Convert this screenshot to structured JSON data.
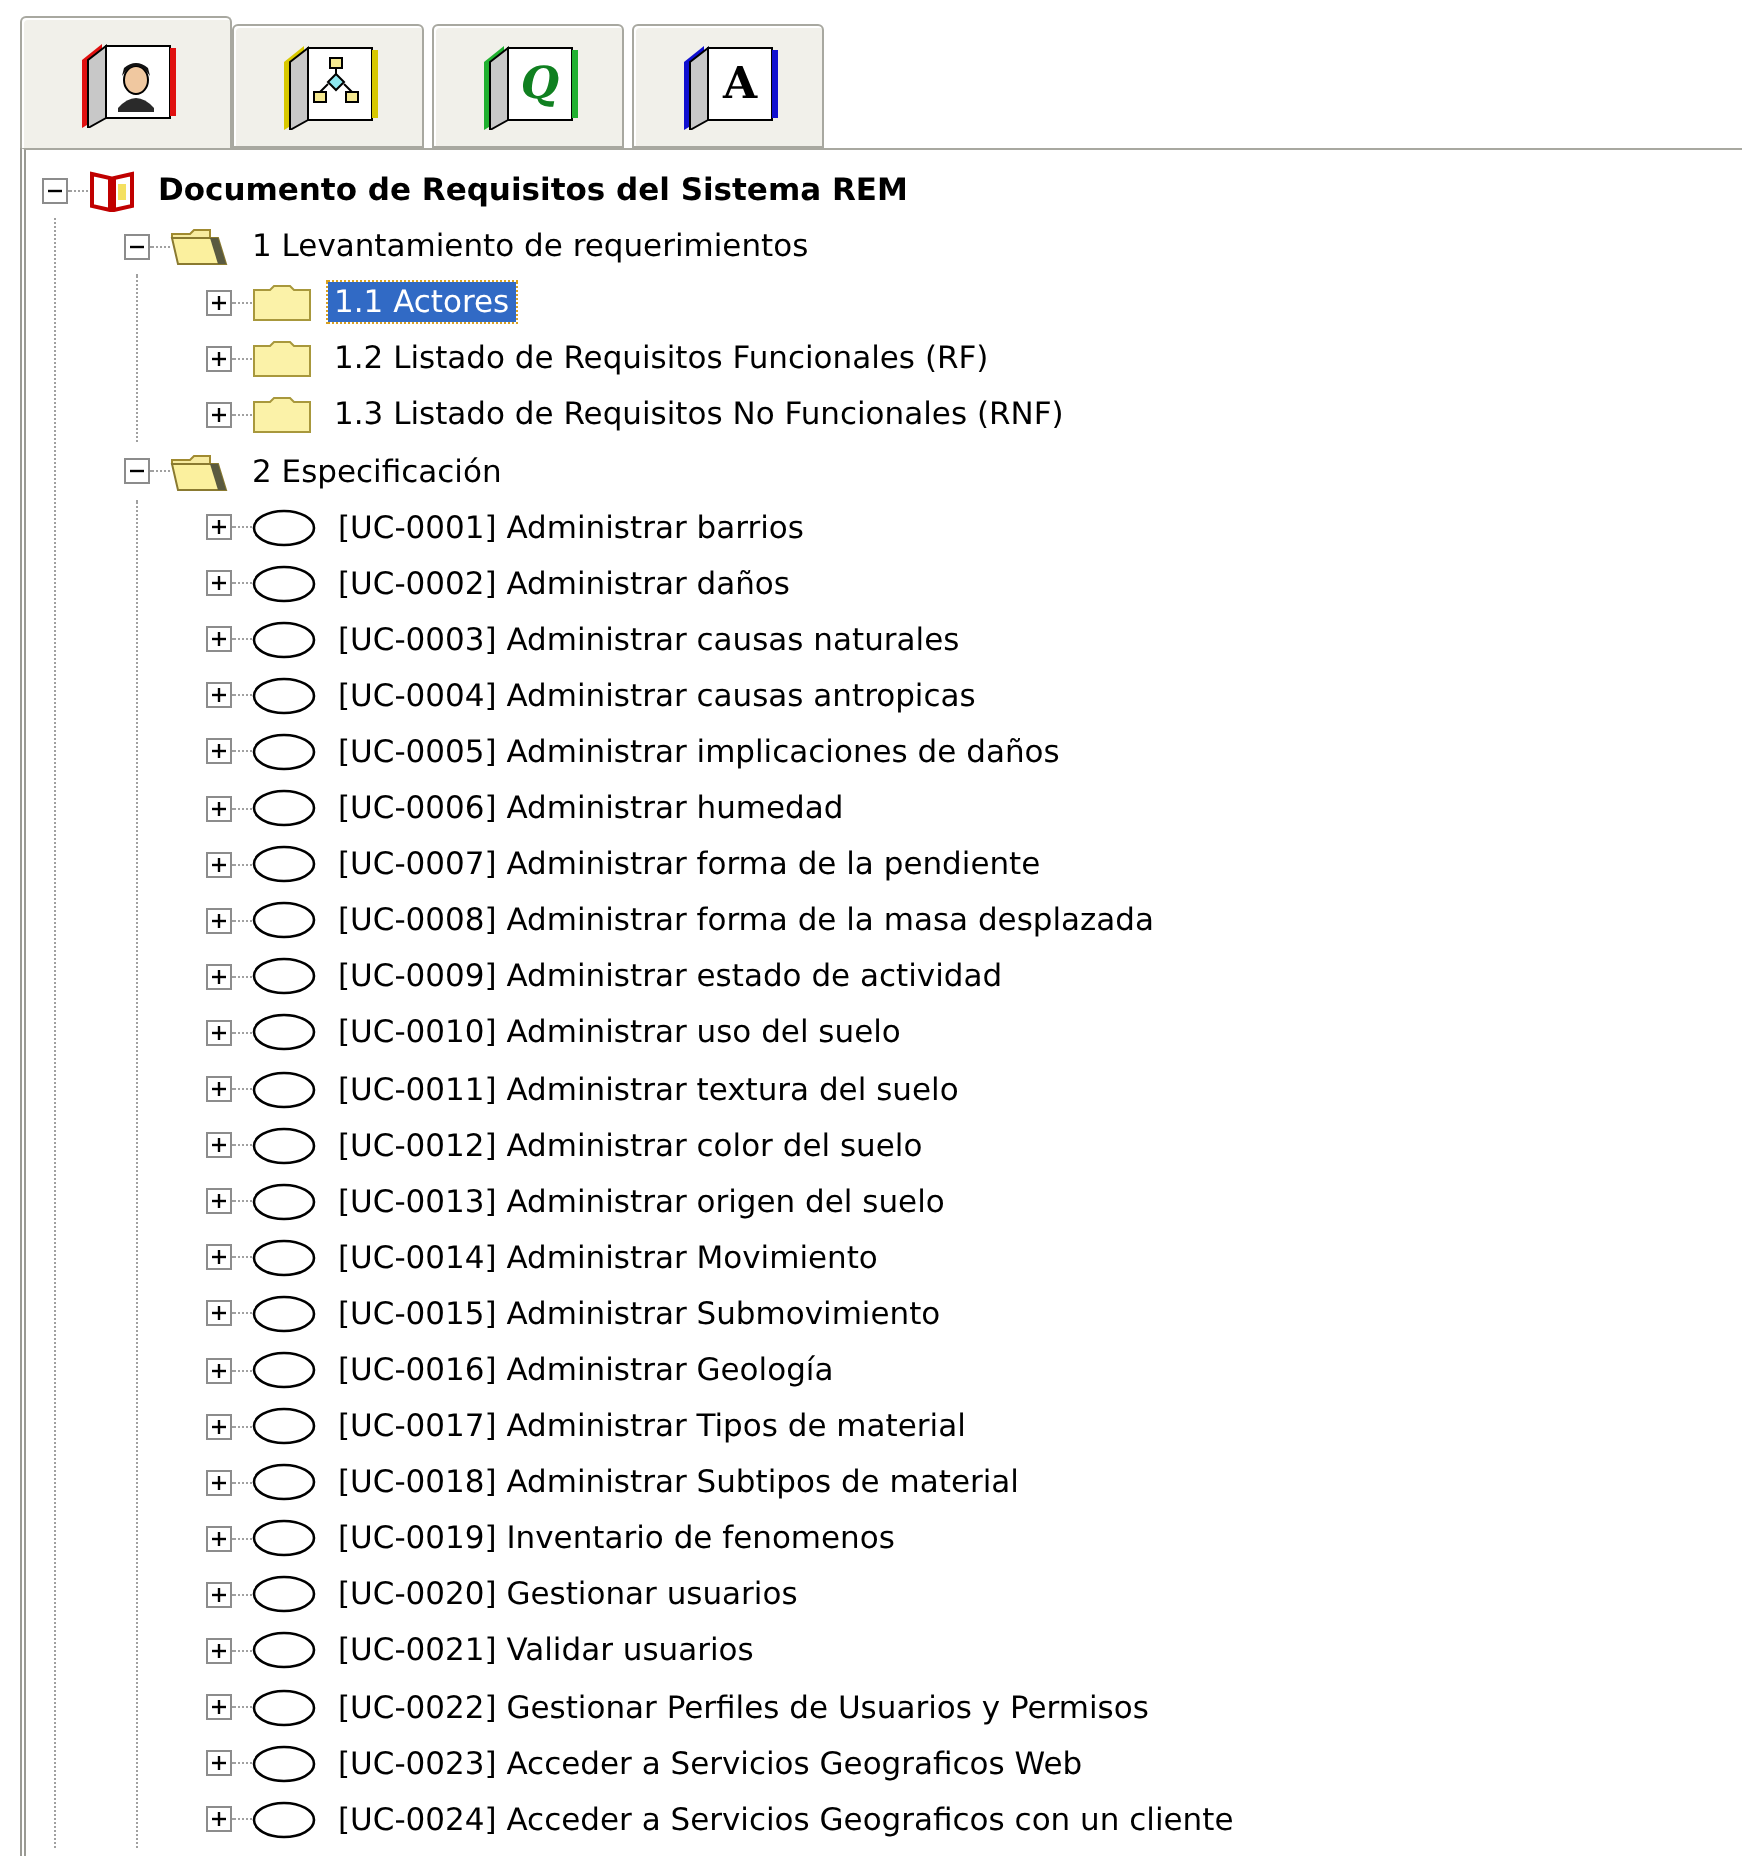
{
  "tabs": [
    {
      "kind": "person",
      "color": "#e01010",
      "selected": true
    },
    {
      "kind": "diagram",
      "color": "#d8c800",
      "selected": false
    },
    {
      "kind": "letter",
      "glyph": "Q",
      "color": "#20b030",
      "selected": false
    },
    {
      "kind": "letter",
      "glyph": "A",
      "color": "#1010d0",
      "selected": false
    }
  ],
  "tree": {
    "label": "Documento de Requisitos del Sistema REM",
    "kind": "document",
    "expanded": true,
    "selected": false,
    "children": [
      {
        "label": "1 Levantamiento de requerimientos",
        "kind": "folder",
        "expanded": true,
        "selected": false,
        "children": [
          {
            "label": "1.1 Actores",
            "kind": "folder",
            "expanded": false,
            "selected": true
          },
          {
            "label": "1.2 Listado de Requisitos Funcionales (RF)",
            "kind": "folder",
            "expanded": false,
            "selected": false
          },
          {
            "label": "1.3 Listado de Requisitos No Funcionales (RNF)",
            "kind": "folder",
            "expanded": false,
            "selected": false
          }
        ]
      },
      {
        "label": "2 Especificación",
        "kind": "folder",
        "expanded": true,
        "selected": false,
        "children": [
          {
            "label": "[UC-0001] Administrar barrios",
            "kind": "use_case",
            "expanded": false,
            "selected": false
          },
          {
            "label": "[UC-0002] Administrar daños",
            "kind": "use_case",
            "expanded": false,
            "selected": false
          },
          {
            "label": "[UC-0003] Administrar causas naturales",
            "kind": "use_case",
            "expanded": false,
            "selected": false
          },
          {
            "label": "[UC-0004] Administrar causas antropicas",
            "kind": "use_case",
            "expanded": false,
            "selected": false
          },
          {
            "label": "[UC-0005] Administrar implicaciones de daños",
            "kind": "use_case",
            "expanded": false,
            "selected": false
          },
          {
            "label": "[UC-0006] Administrar humedad",
            "kind": "use_case",
            "expanded": false,
            "selected": false
          },
          {
            "label": "[UC-0007] Administrar forma de la pendiente",
            "kind": "use_case",
            "expanded": false,
            "selected": false
          },
          {
            "label": "[UC-0008] Administrar forma de la masa desplazada",
            "kind": "use_case",
            "expanded": false,
            "selected": false
          },
          {
            "label": "[UC-0009] Administrar estado de actividad",
            "kind": "use_case",
            "expanded": false,
            "selected": false
          },
          {
            "label": "[UC-0010] Administrar uso del suelo",
            "kind": "use_case",
            "expanded": false,
            "selected": false
          },
          {
            "label": "[UC-0011] Administrar textura del suelo",
            "kind": "use_case",
            "expanded": false,
            "selected": false
          },
          {
            "label": "[UC-0012] Administrar color del suelo",
            "kind": "use_case",
            "expanded": false,
            "selected": false
          },
          {
            "label": "[UC-0013] Administrar origen del suelo",
            "kind": "use_case",
            "expanded": false,
            "selected": false
          },
          {
            "label": "[UC-0014] Administrar Movimiento",
            "kind": "use_case",
            "expanded": false,
            "selected": false
          },
          {
            "label": "[UC-0015] Administrar Submovimiento",
            "kind": "use_case",
            "expanded": false,
            "selected": false
          },
          {
            "label": "[UC-0016] Administrar Geología",
            "kind": "use_case",
            "expanded": false,
            "selected": false
          },
          {
            "label": "[UC-0017] Administrar Tipos de material",
            "kind": "use_case",
            "expanded": false,
            "selected": false
          },
          {
            "label": "[UC-0018] Administrar Subtipos de material",
            "kind": "use_case",
            "expanded": false,
            "selected": false
          },
          {
            "label": "[UC-0019] Inventario de fenomenos",
            "kind": "use_case",
            "expanded": false,
            "selected": false
          },
          {
            "label": "[UC-0020] Gestionar usuarios",
            "kind": "use_case",
            "expanded": false,
            "selected": false
          },
          {
            "label": "[UC-0021] Validar usuarios",
            "kind": "use_case",
            "expanded": false,
            "selected": false
          },
          {
            "label": "[UC-0022] Gestionar Perfiles de Usuarios y Permisos",
            "kind": "use_case",
            "expanded": false,
            "selected": false
          },
          {
            "label": "[UC-0023] Acceder a Servicios Geograficos Web",
            "kind": "use_case",
            "expanded": false,
            "selected": false
          },
          {
            "label": "[UC-0024] Acceder a Servicios Geograficos con un cliente",
            "kind": "use_case",
            "expanded": false,
            "selected": false
          }
        ]
      }
    ]
  }
}
